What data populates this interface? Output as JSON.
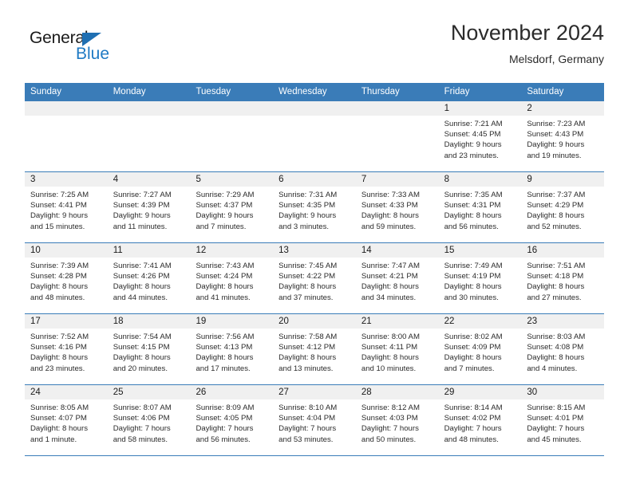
{
  "logo": {
    "word_one": "General",
    "word_two": "Blue",
    "triangle_color": "#1f6fb2",
    "blue_color": "#1f7ac4"
  },
  "header": {
    "title": "November 2024",
    "subtitle": "Melsdorf, Germany"
  },
  "theme": {
    "header_blue": "#3a7cb8",
    "day_band_gray": "#f0f0f0",
    "text_color": "#2b2b2b"
  },
  "weekdays": [
    "Sunday",
    "Monday",
    "Tuesday",
    "Wednesday",
    "Thursday",
    "Friday",
    "Saturday"
  ],
  "weeks": [
    [
      {
        "day": "",
        "empty": true
      },
      {
        "day": "",
        "empty": true
      },
      {
        "day": "",
        "empty": true
      },
      {
        "day": "",
        "empty": true
      },
      {
        "day": "",
        "empty": true
      },
      {
        "day": "1",
        "sunrise": "Sunrise: 7:21 AM",
        "sunset": "Sunset: 4:45 PM",
        "daylight_1": "Daylight: 9 hours",
        "daylight_2": "and 23 minutes."
      },
      {
        "day": "2",
        "sunrise": "Sunrise: 7:23 AM",
        "sunset": "Sunset: 4:43 PM",
        "daylight_1": "Daylight: 9 hours",
        "daylight_2": "and 19 minutes."
      }
    ],
    [
      {
        "day": "3",
        "sunrise": "Sunrise: 7:25 AM",
        "sunset": "Sunset: 4:41 PM",
        "daylight_1": "Daylight: 9 hours",
        "daylight_2": "and 15 minutes."
      },
      {
        "day": "4",
        "sunrise": "Sunrise: 7:27 AM",
        "sunset": "Sunset: 4:39 PM",
        "daylight_1": "Daylight: 9 hours",
        "daylight_2": "and 11 minutes."
      },
      {
        "day": "5",
        "sunrise": "Sunrise: 7:29 AM",
        "sunset": "Sunset: 4:37 PM",
        "daylight_1": "Daylight: 9 hours",
        "daylight_2": "and 7 minutes."
      },
      {
        "day": "6",
        "sunrise": "Sunrise: 7:31 AM",
        "sunset": "Sunset: 4:35 PM",
        "daylight_1": "Daylight: 9 hours",
        "daylight_2": "and 3 minutes."
      },
      {
        "day": "7",
        "sunrise": "Sunrise: 7:33 AM",
        "sunset": "Sunset: 4:33 PM",
        "daylight_1": "Daylight: 8 hours",
        "daylight_2": "and 59 minutes."
      },
      {
        "day": "8",
        "sunrise": "Sunrise: 7:35 AM",
        "sunset": "Sunset: 4:31 PM",
        "daylight_1": "Daylight: 8 hours",
        "daylight_2": "and 56 minutes."
      },
      {
        "day": "9",
        "sunrise": "Sunrise: 7:37 AM",
        "sunset": "Sunset: 4:29 PM",
        "daylight_1": "Daylight: 8 hours",
        "daylight_2": "and 52 minutes."
      }
    ],
    [
      {
        "day": "10",
        "sunrise": "Sunrise: 7:39 AM",
        "sunset": "Sunset: 4:28 PM",
        "daylight_1": "Daylight: 8 hours",
        "daylight_2": "and 48 minutes."
      },
      {
        "day": "11",
        "sunrise": "Sunrise: 7:41 AM",
        "sunset": "Sunset: 4:26 PM",
        "daylight_1": "Daylight: 8 hours",
        "daylight_2": "and 44 minutes."
      },
      {
        "day": "12",
        "sunrise": "Sunrise: 7:43 AM",
        "sunset": "Sunset: 4:24 PM",
        "daylight_1": "Daylight: 8 hours",
        "daylight_2": "and 41 minutes."
      },
      {
        "day": "13",
        "sunrise": "Sunrise: 7:45 AM",
        "sunset": "Sunset: 4:22 PM",
        "daylight_1": "Daylight: 8 hours",
        "daylight_2": "and 37 minutes."
      },
      {
        "day": "14",
        "sunrise": "Sunrise: 7:47 AM",
        "sunset": "Sunset: 4:21 PM",
        "daylight_1": "Daylight: 8 hours",
        "daylight_2": "and 34 minutes."
      },
      {
        "day": "15",
        "sunrise": "Sunrise: 7:49 AM",
        "sunset": "Sunset: 4:19 PM",
        "daylight_1": "Daylight: 8 hours",
        "daylight_2": "and 30 minutes."
      },
      {
        "day": "16",
        "sunrise": "Sunrise: 7:51 AM",
        "sunset": "Sunset: 4:18 PM",
        "daylight_1": "Daylight: 8 hours",
        "daylight_2": "and 27 minutes."
      }
    ],
    [
      {
        "day": "17",
        "sunrise": "Sunrise: 7:52 AM",
        "sunset": "Sunset: 4:16 PM",
        "daylight_1": "Daylight: 8 hours",
        "daylight_2": "and 23 minutes."
      },
      {
        "day": "18",
        "sunrise": "Sunrise: 7:54 AM",
        "sunset": "Sunset: 4:15 PM",
        "daylight_1": "Daylight: 8 hours",
        "daylight_2": "and 20 minutes."
      },
      {
        "day": "19",
        "sunrise": "Sunrise: 7:56 AM",
        "sunset": "Sunset: 4:13 PM",
        "daylight_1": "Daylight: 8 hours",
        "daylight_2": "and 17 minutes."
      },
      {
        "day": "20",
        "sunrise": "Sunrise: 7:58 AM",
        "sunset": "Sunset: 4:12 PM",
        "daylight_1": "Daylight: 8 hours",
        "daylight_2": "and 13 minutes."
      },
      {
        "day": "21",
        "sunrise": "Sunrise: 8:00 AM",
        "sunset": "Sunset: 4:11 PM",
        "daylight_1": "Daylight: 8 hours",
        "daylight_2": "and 10 minutes."
      },
      {
        "day": "22",
        "sunrise": "Sunrise: 8:02 AM",
        "sunset": "Sunset: 4:09 PM",
        "daylight_1": "Daylight: 8 hours",
        "daylight_2": "and 7 minutes."
      },
      {
        "day": "23",
        "sunrise": "Sunrise: 8:03 AM",
        "sunset": "Sunset: 4:08 PM",
        "daylight_1": "Daylight: 8 hours",
        "daylight_2": "and 4 minutes."
      }
    ],
    [
      {
        "day": "24",
        "sunrise": "Sunrise: 8:05 AM",
        "sunset": "Sunset: 4:07 PM",
        "daylight_1": "Daylight: 8 hours",
        "daylight_2": "and 1 minute."
      },
      {
        "day": "25",
        "sunrise": "Sunrise: 8:07 AM",
        "sunset": "Sunset: 4:06 PM",
        "daylight_1": "Daylight: 7 hours",
        "daylight_2": "and 58 minutes."
      },
      {
        "day": "26",
        "sunrise": "Sunrise: 8:09 AM",
        "sunset": "Sunset: 4:05 PM",
        "daylight_1": "Daylight: 7 hours",
        "daylight_2": "and 56 minutes."
      },
      {
        "day": "27",
        "sunrise": "Sunrise: 8:10 AM",
        "sunset": "Sunset: 4:04 PM",
        "daylight_1": "Daylight: 7 hours",
        "daylight_2": "and 53 minutes."
      },
      {
        "day": "28",
        "sunrise": "Sunrise: 8:12 AM",
        "sunset": "Sunset: 4:03 PM",
        "daylight_1": "Daylight: 7 hours",
        "daylight_2": "and 50 minutes."
      },
      {
        "day": "29",
        "sunrise": "Sunrise: 8:14 AM",
        "sunset": "Sunset: 4:02 PM",
        "daylight_1": "Daylight: 7 hours",
        "daylight_2": "and 48 minutes."
      },
      {
        "day": "30",
        "sunrise": "Sunrise: 8:15 AM",
        "sunset": "Sunset: 4:01 PM",
        "daylight_1": "Daylight: 7 hours",
        "daylight_2": "and 45 minutes."
      }
    ]
  ]
}
